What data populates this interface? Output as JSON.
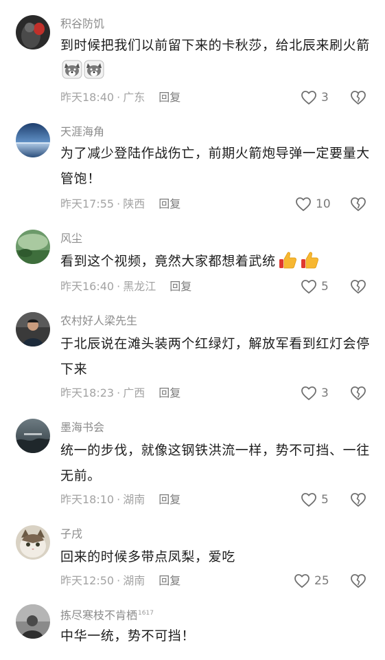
{
  "comments": [
    {
      "username": "积谷防饥",
      "text": "到时候把我们以前留下来的卡秋莎，给北辰来刷火箭",
      "emoji": [
        "wolf-emoji",
        "wolf-emoji"
      ],
      "time": "昨天18:40",
      "location": "广东",
      "reply_label": "回复",
      "likes": "3"
    },
    {
      "username": "天涯海角",
      "text": "为了减少登陆作战伤亡，前期火箭炮导弹一定要量大管饱！",
      "time": "昨天17:55",
      "location": "陕西",
      "reply_label": "回复",
      "likes": "10"
    },
    {
      "username": "风尘",
      "text": "看到这个视频，竟然大家都想着武统",
      "emoji": [
        "thumbs-up-emoji",
        "thumbs-up-emoji"
      ],
      "time": "昨天16:40",
      "location": "黑龙江",
      "reply_label": "回复",
      "likes": "5"
    },
    {
      "username": "农村好人梁先生",
      "text": "于北辰说在滩头装两个红绿灯，解放军看到红灯会停下来",
      "time": "昨天18:23",
      "location": "广西",
      "reply_label": "回复",
      "likes": "3"
    },
    {
      "username": "墨海书会",
      "text": "统一的步伐，就像这钢铁洪流一样，势不可挡、一往无前。",
      "time": "昨天18:10",
      "location": "湖南",
      "reply_label": "回复",
      "likes": "5"
    },
    {
      "username": "子戌",
      "text": "回来的时候多带点凤梨，爱吃",
      "time": "昨天12:50",
      "location": "湖南",
      "reply_label": "回复",
      "likes": "25"
    },
    {
      "username": "拣尽寒枝不肯栖",
      "username_badge": "1617",
      "text": "中华一统，势不可挡！"
    }
  ],
  "separator": "·",
  "colors": {
    "meta_gray": "#a3a3a3",
    "username_gray": "#8c8c8c",
    "text": "#1c1c1c"
  },
  "icons": {
    "like": "heart-outline-icon",
    "dislike": "broken-heart-icon"
  }
}
